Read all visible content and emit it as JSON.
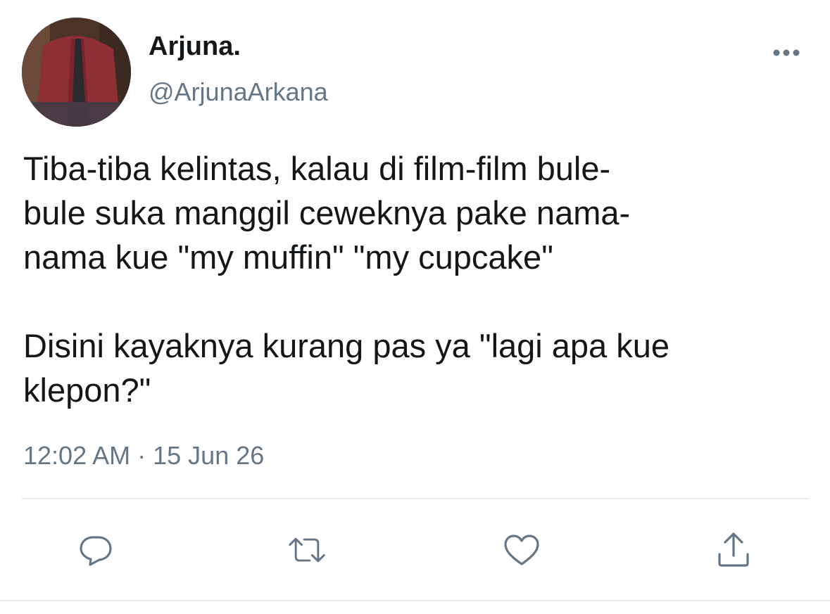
{
  "tweet": {
    "author": {
      "display_name": "Arjuna.",
      "handle": "@ArjunaArkana"
    },
    "text": "Tiba-tiba kelintas, kalau di film-film bule-\nbule suka manggil ceweknya pake nama-\nnama kue \"my muffin\" \"my cupcake\"\n\nDisini kayaknya kurang pas ya \"lagi apa kue\nklepon?\"",
    "time": "12:02 AM",
    "separator": "·",
    "date": "15 Jun 26"
  },
  "icons": {
    "more": "more-horizontal-icon",
    "reply": "reply-icon",
    "retweet": "retweet-icon",
    "like": "heart-icon",
    "share": "share-icon"
  },
  "colors": {
    "text": "#14171a",
    "secondary": "#657786",
    "divider": "#e6ecf0",
    "icon": "#657786"
  }
}
